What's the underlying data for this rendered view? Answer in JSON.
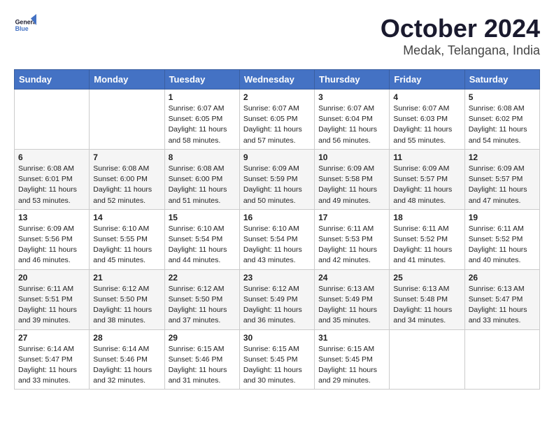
{
  "header": {
    "logo_line1": "General",
    "logo_line2": "Blue",
    "month": "October 2024",
    "location": "Medak, Telangana, India"
  },
  "days_of_week": [
    "Sunday",
    "Monday",
    "Tuesday",
    "Wednesday",
    "Thursday",
    "Friday",
    "Saturday"
  ],
  "weeks": [
    [
      {
        "day": "",
        "sunrise": "",
        "sunset": "",
        "daylight": ""
      },
      {
        "day": "",
        "sunrise": "",
        "sunset": "",
        "daylight": ""
      },
      {
        "day": "1",
        "sunrise": "Sunrise: 6:07 AM",
        "sunset": "Sunset: 6:05 PM",
        "daylight": "Daylight: 11 hours and 58 minutes."
      },
      {
        "day": "2",
        "sunrise": "Sunrise: 6:07 AM",
        "sunset": "Sunset: 6:05 PM",
        "daylight": "Daylight: 11 hours and 57 minutes."
      },
      {
        "day": "3",
        "sunrise": "Sunrise: 6:07 AM",
        "sunset": "Sunset: 6:04 PM",
        "daylight": "Daylight: 11 hours and 56 minutes."
      },
      {
        "day": "4",
        "sunrise": "Sunrise: 6:07 AM",
        "sunset": "Sunset: 6:03 PM",
        "daylight": "Daylight: 11 hours and 55 minutes."
      },
      {
        "day": "5",
        "sunrise": "Sunrise: 6:08 AM",
        "sunset": "Sunset: 6:02 PM",
        "daylight": "Daylight: 11 hours and 54 minutes."
      }
    ],
    [
      {
        "day": "6",
        "sunrise": "Sunrise: 6:08 AM",
        "sunset": "Sunset: 6:01 PM",
        "daylight": "Daylight: 11 hours and 53 minutes."
      },
      {
        "day": "7",
        "sunrise": "Sunrise: 6:08 AM",
        "sunset": "Sunset: 6:00 PM",
        "daylight": "Daylight: 11 hours and 52 minutes."
      },
      {
        "day": "8",
        "sunrise": "Sunrise: 6:08 AM",
        "sunset": "Sunset: 6:00 PM",
        "daylight": "Daylight: 11 hours and 51 minutes."
      },
      {
        "day": "9",
        "sunrise": "Sunrise: 6:09 AM",
        "sunset": "Sunset: 5:59 PM",
        "daylight": "Daylight: 11 hours and 50 minutes."
      },
      {
        "day": "10",
        "sunrise": "Sunrise: 6:09 AM",
        "sunset": "Sunset: 5:58 PM",
        "daylight": "Daylight: 11 hours and 49 minutes."
      },
      {
        "day": "11",
        "sunrise": "Sunrise: 6:09 AM",
        "sunset": "Sunset: 5:57 PM",
        "daylight": "Daylight: 11 hours and 48 minutes."
      },
      {
        "day": "12",
        "sunrise": "Sunrise: 6:09 AM",
        "sunset": "Sunset: 5:57 PM",
        "daylight": "Daylight: 11 hours and 47 minutes."
      }
    ],
    [
      {
        "day": "13",
        "sunrise": "Sunrise: 6:09 AM",
        "sunset": "Sunset: 5:56 PM",
        "daylight": "Daylight: 11 hours and 46 minutes."
      },
      {
        "day": "14",
        "sunrise": "Sunrise: 6:10 AM",
        "sunset": "Sunset: 5:55 PM",
        "daylight": "Daylight: 11 hours and 45 minutes."
      },
      {
        "day": "15",
        "sunrise": "Sunrise: 6:10 AM",
        "sunset": "Sunset: 5:54 PM",
        "daylight": "Daylight: 11 hours and 44 minutes."
      },
      {
        "day": "16",
        "sunrise": "Sunrise: 6:10 AM",
        "sunset": "Sunset: 5:54 PM",
        "daylight": "Daylight: 11 hours and 43 minutes."
      },
      {
        "day": "17",
        "sunrise": "Sunrise: 6:11 AM",
        "sunset": "Sunset: 5:53 PM",
        "daylight": "Daylight: 11 hours and 42 minutes."
      },
      {
        "day": "18",
        "sunrise": "Sunrise: 6:11 AM",
        "sunset": "Sunset: 5:52 PM",
        "daylight": "Daylight: 11 hours and 41 minutes."
      },
      {
        "day": "19",
        "sunrise": "Sunrise: 6:11 AM",
        "sunset": "Sunset: 5:52 PM",
        "daylight": "Daylight: 11 hours and 40 minutes."
      }
    ],
    [
      {
        "day": "20",
        "sunrise": "Sunrise: 6:11 AM",
        "sunset": "Sunset: 5:51 PM",
        "daylight": "Daylight: 11 hours and 39 minutes."
      },
      {
        "day": "21",
        "sunrise": "Sunrise: 6:12 AM",
        "sunset": "Sunset: 5:50 PM",
        "daylight": "Daylight: 11 hours and 38 minutes."
      },
      {
        "day": "22",
        "sunrise": "Sunrise: 6:12 AM",
        "sunset": "Sunset: 5:50 PM",
        "daylight": "Daylight: 11 hours and 37 minutes."
      },
      {
        "day": "23",
        "sunrise": "Sunrise: 6:12 AM",
        "sunset": "Sunset: 5:49 PM",
        "daylight": "Daylight: 11 hours and 36 minutes."
      },
      {
        "day": "24",
        "sunrise": "Sunrise: 6:13 AM",
        "sunset": "Sunset: 5:49 PM",
        "daylight": "Daylight: 11 hours and 35 minutes."
      },
      {
        "day": "25",
        "sunrise": "Sunrise: 6:13 AM",
        "sunset": "Sunset: 5:48 PM",
        "daylight": "Daylight: 11 hours and 34 minutes."
      },
      {
        "day": "26",
        "sunrise": "Sunrise: 6:13 AM",
        "sunset": "Sunset: 5:47 PM",
        "daylight": "Daylight: 11 hours and 33 minutes."
      }
    ],
    [
      {
        "day": "27",
        "sunrise": "Sunrise: 6:14 AM",
        "sunset": "Sunset: 5:47 PM",
        "daylight": "Daylight: 11 hours and 33 minutes."
      },
      {
        "day": "28",
        "sunrise": "Sunrise: 6:14 AM",
        "sunset": "Sunset: 5:46 PM",
        "daylight": "Daylight: 11 hours and 32 minutes."
      },
      {
        "day": "29",
        "sunrise": "Sunrise: 6:15 AM",
        "sunset": "Sunset: 5:46 PM",
        "daylight": "Daylight: 11 hours and 31 minutes."
      },
      {
        "day": "30",
        "sunrise": "Sunrise: 6:15 AM",
        "sunset": "Sunset: 5:45 PM",
        "daylight": "Daylight: 11 hours and 30 minutes."
      },
      {
        "day": "31",
        "sunrise": "Sunrise: 6:15 AM",
        "sunset": "Sunset: 5:45 PM",
        "daylight": "Daylight: 11 hours and 29 minutes."
      },
      {
        "day": "",
        "sunrise": "",
        "sunset": "",
        "daylight": ""
      },
      {
        "day": "",
        "sunrise": "",
        "sunset": "",
        "daylight": ""
      }
    ]
  ]
}
